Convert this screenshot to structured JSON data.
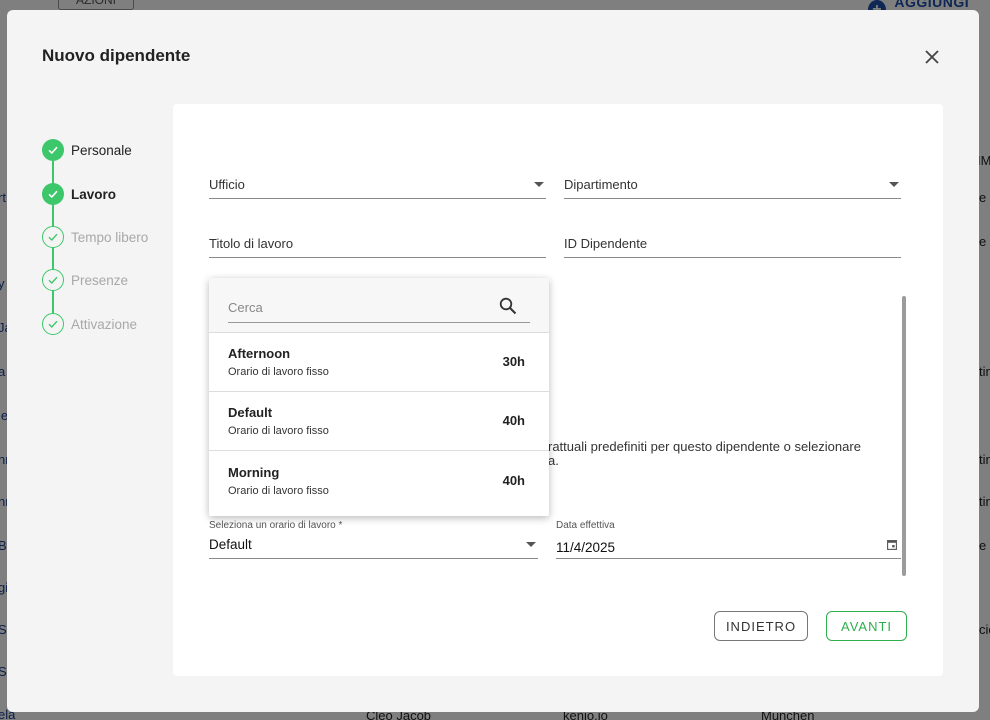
{
  "background": {
    "azioni_label": "AZIONI",
    "aggiungi_label": "AGGIUNGI DIP",
    "row_fragments_left": [
      "rt",
      "y",
      "Ja",
      "a",
      "le",
      "nr",
      "nr",
      "B",
      "gi",
      "S",
      "S",
      "ela"
    ],
    "row_fragments_right": [
      "IM",
      "e",
      "e",
      "tin",
      "tin",
      "tin",
      "e",
      "cic"
    ],
    "bottom_row": {
      "name": "Cleo Jacob",
      "company": "kenjo.io",
      "city": "Munchen"
    }
  },
  "modal": {
    "title": "Nuovo dipendente"
  },
  "stepper": {
    "steps": [
      {
        "label": "Personale",
        "state": "done"
      },
      {
        "label": "Lavoro",
        "state": "active"
      },
      {
        "label": "Tempo libero",
        "state": "pending"
      },
      {
        "label": "Presenze",
        "state": "pending"
      },
      {
        "label": "Attivazione",
        "state": "pending"
      }
    ]
  },
  "form": {
    "ufficio_label": "Ufficio",
    "dipartimento_label": "Dipartimento",
    "titolo_label": "Titolo di lavoro",
    "id_label": "ID Dipendente",
    "partial_line1": "rattuali predefiniti per questo dipendente o selezionare",
    "partial_line2": "a.",
    "schedule_label": "Seleziona un orario di lavoro *",
    "schedule_value": "Default",
    "date_label": "Data effettiva",
    "date_value": "11/4/2025"
  },
  "dropdown": {
    "search_placeholder": "Cerca",
    "items": [
      {
        "title": "Afternoon",
        "subtitle": "Orario di lavoro fisso",
        "hours": "30h"
      },
      {
        "title": "Default",
        "subtitle": "Orario di lavoro fisso",
        "hours": "40h"
      },
      {
        "title": "Morning",
        "subtitle": "Orario di lavoro fisso",
        "hours": "40h"
      }
    ]
  },
  "buttons": {
    "back_label": "INDIETRO",
    "next_label": "AVANTI"
  },
  "colors": {
    "accent_green": "#3cc76a",
    "button_green": "#2fae4d",
    "link_blue": "#1d4fa8"
  }
}
